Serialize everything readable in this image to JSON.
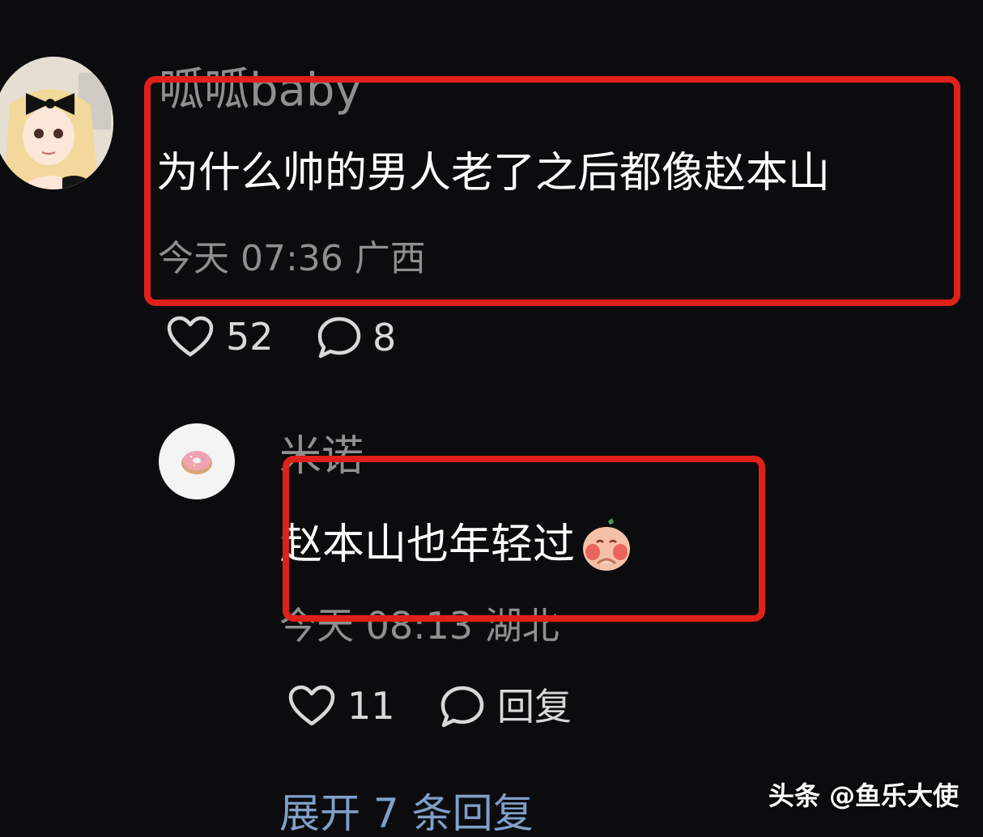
{
  "comment": {
    "username": "呱呱baby",
    "text": "为什么帅的男人老了之后都像赵本山",
    "time": "今天 07:36 广西",
    "likes": "52",
    "replies": "8"
  },
  "reply": {
    "username": "米诺",
    "text": "赵本山也年轻过",
    "time": "今天 08:13 湖北",
    "likes": "11",
    "reply_label": "回复"
  },
  "expand_label": "展开 7 条回复",
  "watermark": "头条 @鱼乐大使",
  "colors": {
    "background": "#0c0c0e",
    "highlight": "#e0201a",
    "link": "#7f9fc9"
  },
  "icons": [
    "heart-icon",
    "comment-bubble-icon",
    "emoji-icon"
  ]
}
